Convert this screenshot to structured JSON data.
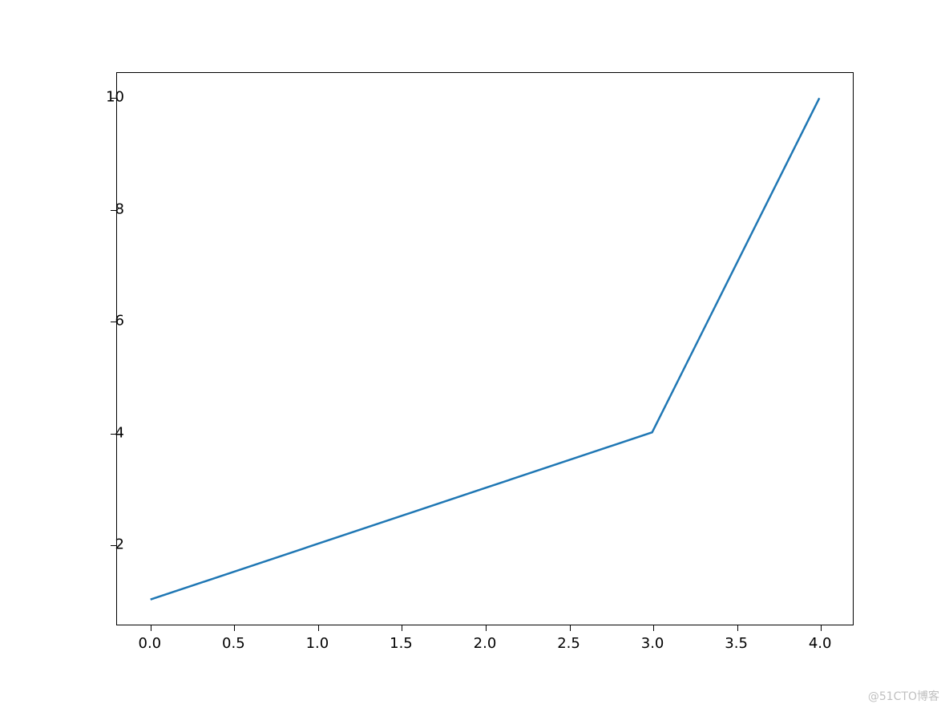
{
  "chart_data": {
    "type": "line",
    "x": [
      0,
      1,
      2,
      3,
      4
    ],
    "y": [
      1,
      2,
      3,
      4,
      10
    ],
    "xlim": [
      -0.2,
      4.2
    ],
    "ylim": [
      0.55,
      10.45
    ],
    "x_ticks": [
      0.0,
      0.5,
      1.0,
      1.5,
      2.0,
      2.5,
      3.0,
      3.5,
      4.0
    ],
    "x_tick_labels": [
      "0.0",
      "0.5",
      "1.0",
      "1.5",
      "2.0",
      "2.5",
      "3.0",
      "3.5",
      "4.0"
    ],
    "y_ticks": [
      2,
      4,
      6,
      8,
      10
    ],
    "y_tick_labels": [
      "2",
      "4",
      "6",
      "8",
      "10"
    ],
    "line_color": "#1f77b4",
    "title": "",
    "xlabel": "",
    "ylabel": ""
  },
  "watermark": "@51CTO博客"
}
